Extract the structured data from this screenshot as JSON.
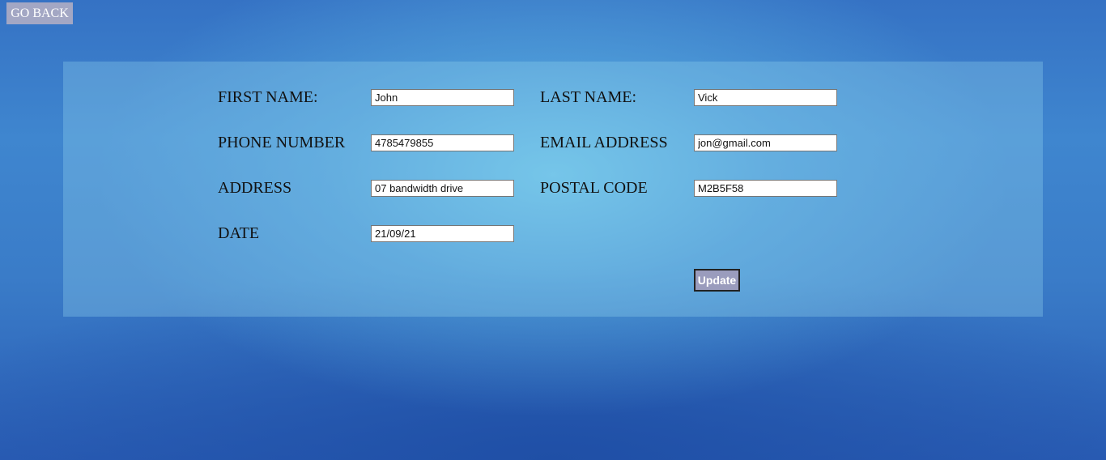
{
  "nav": {
    "go_back_label": "GO BACK"
  },
  "form": {
    "first_name": {
      "label": "FIRST NAME:",
      "value": "John"
    },
    "last_name": {
      "label": "LAST NAME:",
      "value": "Vick"
    },
    "phone_number": {
      "label": "PHONE NUMBER",
      "value": "4785479855"
    },
    "email_address": {
      "label": "EMAIL ADDRESS",
      "value": "jon@gmail.com"
    },
    "address": {
      "label": "ADDRESS",
      "value": "07 bandwidth drive"
    },
    "postal_code": {
      "label": "POSTAL CODE",
      "value": "M2B5F58"
    },
    "date": {
      "label": "DATE",
      "value": "21/09/21"
    },
    "update_label": "Update"
  },
  "colors": {
    "button_bg": "#a3a7c4",
    "update_bg": "#9a9cbd",
    "panel_tint": "#96d7f0"
  }
}
